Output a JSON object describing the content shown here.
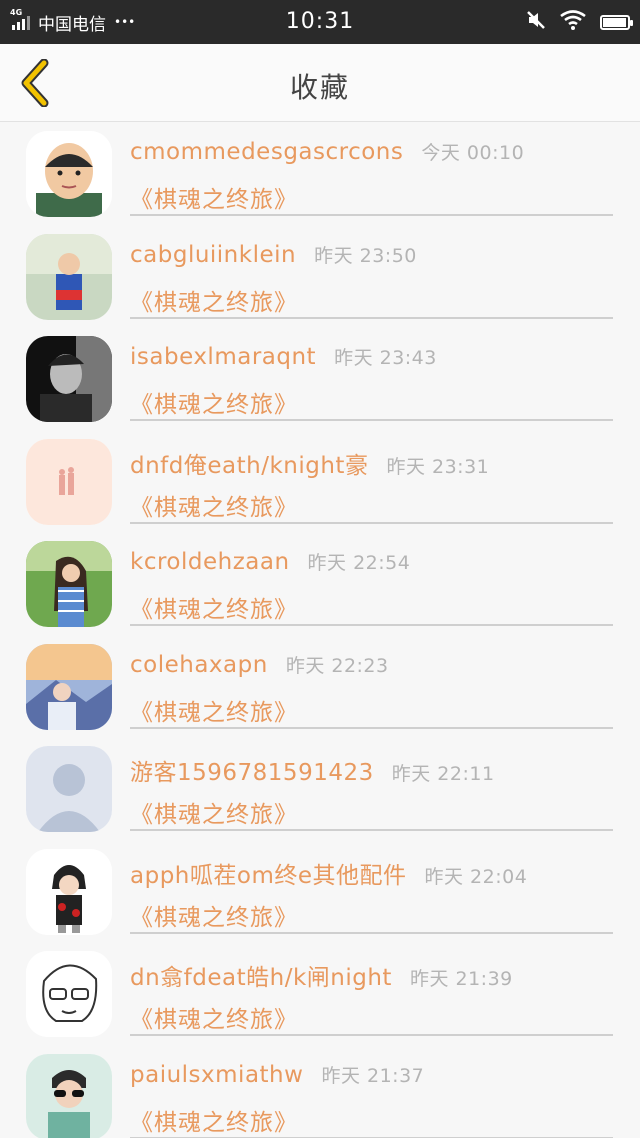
{
  "status_bar": {
    "network": "4G",
    "carrier": "中国电信",
    "dots": "•••",
    "time": "10:31"
  },
  "header": {
    "title": "收藏",
    "accent_color": "#f2c200"
  },
  "favorites": [
    {
      "username": "cmommedesgascrcons",
      "time": "今天 00:10",
      "title": "《棋魂之终旅》",
      "avatar_icon": "cartoon-man-avatar"
    },
    {
      "username": "cabgluiinklein",
      "time": "昨天 23:50",
      "title": "《棋魂之终旅》",
      "avatar_icon": "child-photo-avatar"
    },
    {
      "username": "isabexlmaraqnt",
      "time": "昨天 23:43",
      "title": "《棋魂之终旅》",
      "avatar_icon": "bw-portrait-avatar"
    },
    {
      "username": "dnfd俺eath/knight豪",
      "time": "昨天 23:31",
      "title": "《棋魂之终旅》",
      "avatar_icon": "pale-figure-avatar"
    },
    {
      "username": "kcroldehzaan",
      "time": "昨天 22:54",
      "title": "《棋魂之终旅》",
      "avatar_icon": "girl-outdoor-avatar"
    },
    {
      "username": "colehaxapn",
      "time": "昨天 22:23",
      "title": "《棋魂之终旅》",
      "avatar_icon": "sunset-person-avatar"
    },
    {
      "username": "游客1596781591423",
      "time": "昨天 22:11",
      "title": "《棋魂之终旅》",
      "avatar_icon": "default-silhouette-avatar"
    },
    {
      "username": "apph呱茬om终e其他配件",
      "time": "昨天 22:04",
      "title": "《棋魂之终旅》",
      "avatar_icon": "anime-ninja-avatar"
    },
    {
      "username": "dn翕fdeat皓h/k闸night",
      "time": "昨天 21:39",
      "title": "《棋魂之终旅》",
      "avatar_icon": "sketch-glasses-avatar"
    },
    {
      "username": "paiulsxmiathw",
      "time": "昨天 21:37",
      "title": "《棋魂之终旅》",
      "avatar_icon": "sunglasses-boy-avatar"
    }
  ]
}
